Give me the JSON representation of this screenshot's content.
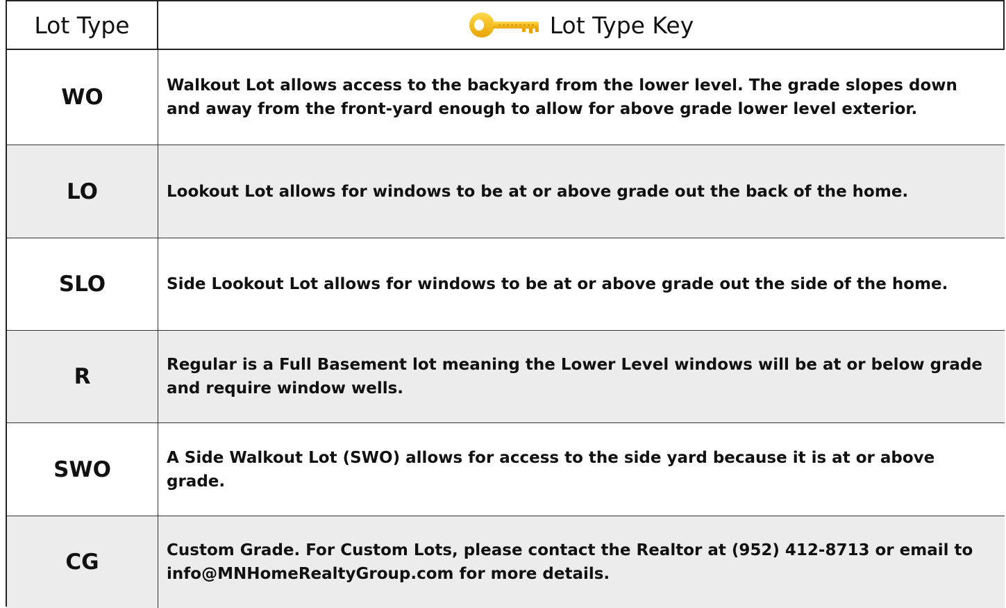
{
  "header": {
    "col1": "Lot Type",
    "col2": "Lot Type Key",
    "icon": "key-icon",
    "icon_color": "#f5b800"
  },
  "rows": [
    {
      "code": "WO",
      "description": "Walkout Lot allows access to the backyard from the lower level. The grade slopes down and away from the front-yard enough to allow for above grade lower level exterior."
    },
    {
      "code": "LO",
      "description": "Lookout Lot allows for windows to be at or above grade out the back of the home."
    },
    {
      "code": "SLO",
      "description": "Side Lookout Lot allows for windows to be at or above grade out the side of the home."
    },
    {
      "code": "R",
      "description": "Regular is a Full Basement lot meaning the Lower Level windows will be at or below grade and require window wells."
    },
    {
      "code": "SWO",
      "description": "A Side Walkout Lot (SWO) allows for access to the side yard because it is at or above grade."
    },
    {
      "code": "CG",
      "description": "Custom Grade. For Custom Lots, please contact the Realtor at (952) 412-8713 or email to info@MNHomeRealtyGroup.com for more details."
    }
  ]
}
